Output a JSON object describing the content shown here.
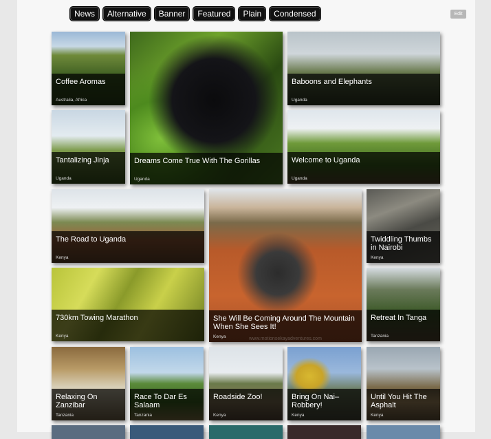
{
  "tabs": [
    "News",
    "Alternative",
    "Banner",
    "Featured",
    "Plain",
    "Condensed"
  ],
  "edit_label": "Edit",
  "tiles": [
    {
      "title": "Coffee Aromas",
      "tag": "Australia, Africa"
    },
    {
      "title": "Dreams Come True With The Gorillas",
      "tag": "Uganda"
    },
    {
      "title": "Baboons and Elephants",
      "tag": "Uganda"
    },
    {
      "title": "Tantalizing Jinja",
      "tag": "Uganda"
    },
    {
      "title": "Welcome to Uganda",
      "tag": "Uganda"
    },
    {
      "title": "The Road to Uganda",
      "tag": "Kenya"
    },
    {
      "title": "She Will Be Coming Around The Mountain When She Sees It!",
      "tag": "Kenya",
      "watermark": "www.motionsekayadventures.com"
    },
    {
      "title": "Twiddling Thumbs in Nairobi",
      "tag": "Kenya"
    },
    {
      "title": "730km Towing Marathon",
      "tag": "Kenya"
    },
    {
      "title": "Retreat In Tanga",
      "tag": "Tanzania"
    },
    {
      "title": "Relaxing On Zanzibar",
      "tag": "Tanzania"
    },
    {
      "title": "Race To Dar Es Salaam",
      "tag": "Tanzania"
    },
    {
      "title": "Roadside Zoo!",
      "tag": "Kenya"
    },
    {
      "title": "Bring On Nai–Robbery!",
      "tag": "Kenya"
    },
    {
      "title": "Until You Hit The Asphalt",
      "tag": "Kenya"
    }
  ]
}
